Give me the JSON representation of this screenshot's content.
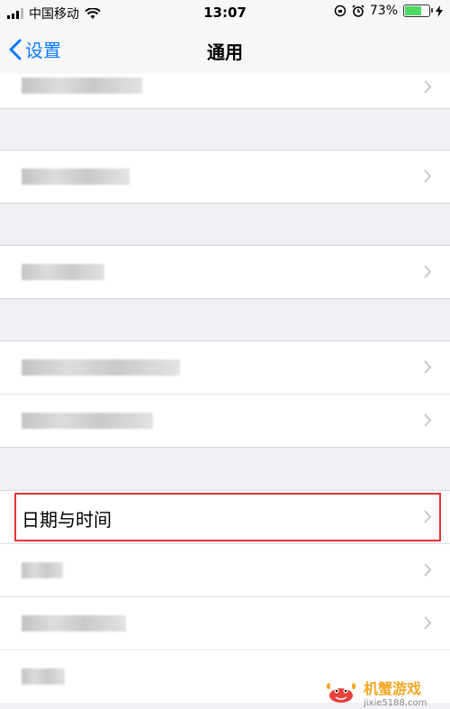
{
  "status_bar": {
    "carrier": "中国移动",
    "time": "13:07",
    "battery": "73%",
    "battery_level": 0.73,
    "battery_color": "#4cd964"
  },
  "nav": {
    "back_label": "设置",
    "title": "通用",
    "accent": "#0a7aff"
  },
  "highlighted_item": {
    "label": "日期与时间"
  },
  "highlight_color": "#e53333",
  "watermark": {
    "name": "机蟹游戏",
    "url": "jixie5188.com"
  }
}
